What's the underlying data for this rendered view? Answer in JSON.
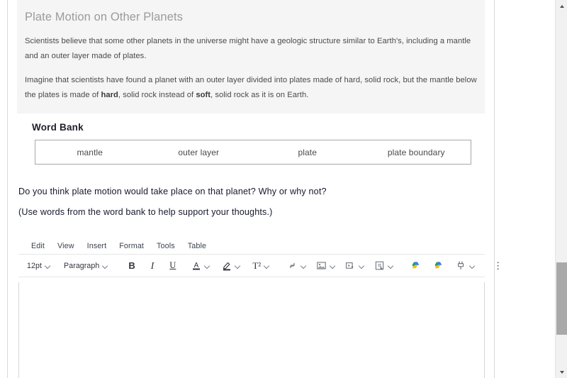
{
  "panel": {
    "title": "Plate Motion on Other Planets",
    "paragraphs": [
      "Scientists believe that some other planets in the universe might have a geologic structure similar to Earth's, including a mantle and an outer layer made of plates.",
      "Imagine that scientists have found a planet with an outer layer divided into plates made of hard, solid rock, but the mantle below the plates is made of |hard|, solid rock instead of |soft|, solid rock as it is on Earth."
    ],
    "bold_terms": [
      "hard",
      "soft"
    ],
    "background_color": "#f5f5f5",
    "title_color": "#9b9b9b"
  },
  "word_bank": {
    "heading": "Word Bank",
    "words": [
      "mantle",
      "outer layer",
      "plate",
      "plate boundary"
    ],
    "border_color": "#a8a8a8"
  },
  "questions": [
    "Do you think plate motion would take place on that planet? Why or why not?",
    "(Use words from the word bank to help support your thoughts.)"
  ],
  "editor": {
    "menubar": [
      "Edit",
      "View",
      "Insert",
      "Format",
      "Tools",
      "Table"
    ],
    "toolbar": {
      "font_size": "12pt",
      "block_format": "Paragraph",
      "bold": "B",
      "italic": "I",
      "underline": "U",
      "text_color": "A",
      "highlight_color": "highlight-pen-icon",
      "formats": "T²",
      "link": "link-icon",
      "image": "image-icon",
      "media": "media-icon",
      "template": "document-template-icon",
      "drive_1": "google-drive-icon",
      "drive_2": "google-drive-icon",
      "plugin": "plug-icon",
      "more": "⋮"
    },
    "body_text": "",
    "drive_colors": [
      "#1d9d58",
      "#f9bc15",
      "#3b7ddd"
    ]
  },
  "scrollbar": {
    "up_arrow": "scroll-up-arrow",
    "down_arrow": "scroll-down-arrow",
    "thumb_color": "#a9a9a9",
    "track_color": "#f1f1f1"
  }
}
